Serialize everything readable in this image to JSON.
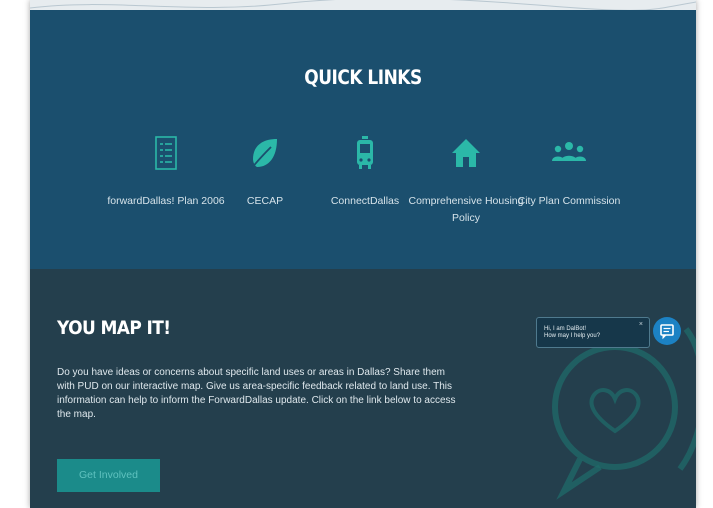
{
  "quick_links": {
    "title": "QUICK LINKS",
    "items": [
      {
        "label": "forwardDallas! Plan 2006",
        "icon": "document-list-icon"
      },
      {
        "label": "CECAP",
        "icon": "leaf-icon"
      },
      {
        "label": "ConnectDallas",
        "icon": "bus-icon"
      },
      {
        "label": "Comprehensive Housing Policy",
        "icon": "house-icon"
      },
      {
        "label": "City Plan Commission",
        "icon": "group-icon"
      }
    ]
  },
  "map_section": {
    "title": "YOU MAP IT!",
    "body": "Do you have ideas or concerns about specific land uses or areas in Dallas? Share them with PUD on our interactive map. Give us area-specific feedback related to land use. This information can help to inform the ForwardDallas update. Click on the link below to access the map.",
    "button_label": "Get Involved"
  },
  "chat": {
    "line1": "Hi, I am DalBot!",
    "line2": "How may I help you?",
    "close": "×"
  },
  "colors": {
    "quick_links_bg": "#1b4f6e",
    "map_bg": "#243f4d",
    "accent_teal": "#1b8b8a",
    "icon_teal": "#2bb8a8",
    "chat_blue": "#1c82c4"
  }
}
